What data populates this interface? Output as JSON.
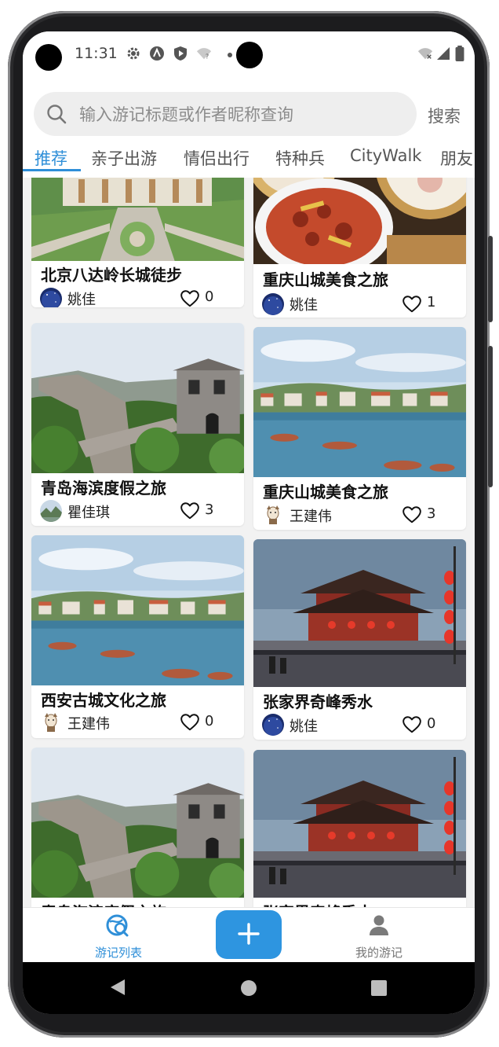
{
  "status_bar": {
    "time": "11:31"
  },
  "search": {
    "placeholder": "输入游记标题或作者昵称查询",
    "button_label": "搜索"
  },
  "tabs": [
    {
      "label": "推荐",
      "active": true
    },
    {
      "label": "亲子出游"
    },
    {
      "label": "情侣出行"
    },
    {
      "label": "特种兵"
    },
    {
      "label": "CityWalk"
    },
    {
      "label": "朋友"
    }
  ],
  "cards": [
    {
      "title": "北京八达岭长城徒步",
      "author": "姚佳",
      "likes": "0",
      "image": "coastal-resort-aerial",
      "avatar": "night-sky"
    },
    {
      "title": "重庆山城美食之旅",
      "author": "姚佳",
      "likes": "1",
      "image": "dim-sum-food",
      "avatar": "night-sky"
    },
    {
      "title": "青岛海滨度假之旅",
      "author": "瞿佳琪",
      "likes": "3",
      "image": "great-wall",
      "avatar": "landscape"
    },
    {
      "title": "重庆山城美食之旅",
      "author": "王建伟",
      "likes": "3",
      "image": "seaside-city",
      "avatar": "cartoon"
    },
    {
      "title": "西安古城文化之旅",
      "author": "王建伟",
      "likes": "0",
      "image": "seaside-city",
      "avatar": "cartoon"
    },
    {
      "title": "张家界奇峰秀水",
      "author": "姚佳",
      "likes": "0",
      "image": "xian-city-wall",
      "avatar": "night-sky"
    },
    {
      "title": "青岛海滨度假之旅",
      "author": "",
      "likes": "",
      "image": "great-wall",
      "avatar": ""
    },
    {
      "title": "张家界奇峰秀水",
      "author": "",
      "likes": "",
      "image": "xian-city-wall",
      "avatar": ""
    }
  ],
  "bottom_nav": {
    "items": [
      {
        "label": "游记列表",
        "icon": "travel-search-icon",
        "active": true
      },
      {
        "label": "我的游记",
        "icon": "person-icon"
      }
    ],
    "fab_icon": "plus-icon"
  },
  "colors": {
    "accent": "#2f8fd8",
    "fab": "#2e95e0",
    "inactive": "#777777",
    "feed_bg": "#f2f2f2"
  }
}
